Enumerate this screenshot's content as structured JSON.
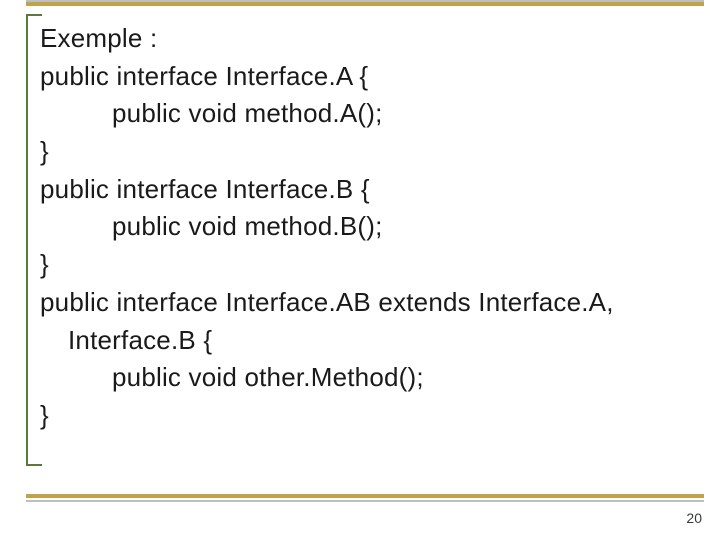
{
  "slide": {
    "page_number": "20",
    "lines": [
      {
        "text": "Exemple :",
        "indent": "none"
      },
      {
        "text": "public interface Interface.A {",
        "indent": "none"
      },
      {
        "text": "public void method.A();",
        "indent": "indent1"
      },
      {
        "text": "}",
        "indent": "none"
      },
      {
        "text": "public interface Interface.B {",
        "indent": "none"
      },
      {
        "text": "public void method.B();",
        "indent": "indent1"
      },
      {
        "text": "}",
        "indent": "none"
      },
      {
        "text": "public interface Interface.AB extends Interface.A,",
        "indent": "none"
      },
      {
        "text": "Interface.B {",
        "indent": "indent-cont"
      },
      {
        "text": "public void other.Method();",
        "indent": "indent1"
      },
      {
        "text": "}",
        "indent": "none"
      }
    ]
  }
}
